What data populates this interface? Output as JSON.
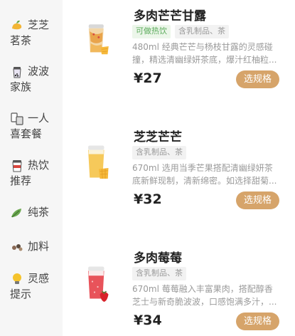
{
  "sidebar": {
    "items": [
      {
        "label": "芝芝茗茶",
        "icon": "mango-tea-icon"
      },
      {
        "label": "波波家族",
        "icon": "boba-cup-icon"
      },
      {
        "label": "一人喜套餐",
        "icon": "combo-meal-icon"
      },
      {
        "label": "热饮推荐",
        "icon": "hot-drink-icon"
      },
      {
        "label": "纯茶",
        "icon": "tea-leaf-icon"
      },
      {
        "label": "加料",
        "icon": "toppings-icon"
      },
      {
        "label": "灵感提示",
        "icon": "lightbulb-icon"
      }
    ]
  },
  "products": [
    {
      "name": "多肉芒芒甘露",
      "tags": [
        {
          "text": "可做热饮",
          "style": "green"
        },
        {
          "text": "含乳制品、茶",
          "style": "grey"
        }
      ],
      "description": "480ml 经典芒芒与杨枝甘露的灵感碰撞，精选清幽绿妍茶底，爆汁红柚粒...",
      "price": "¥27",
      "button": "选规格"
    },
    {
      "name": "芝芝芒芒",
      "tags": [
        {
          "text": "含乳制品、茶",
          "style": "grey"
        }
      ],
      "description": "670ml 选用当季芒果搭配清幽绿妍茶底新鲜现制，清新绵密。如选择甜菊...",
      "price": "¥32",
      "button": "选规格"
    },
    {
      "name": "多肉莓莓",
      "tags": [
        {
          "text": "含乳制品、茶",
          "style": "grey"
        }
      ],
      "description": "670ml 莓莓融入丰富果肉，搭配醇香芝士与新奇脆波波，口感饱满多汁，...",
      "price": "¥34",
      "button": "选规格"
    }
  ],
  "colors": {
    "accent": "#d6a46a",
    "sidebar_bg": "#f6f6f6",
    "tag_green": "#5bab5b",
    "tag_green_bg": "#ecf6ea"
  }
}
